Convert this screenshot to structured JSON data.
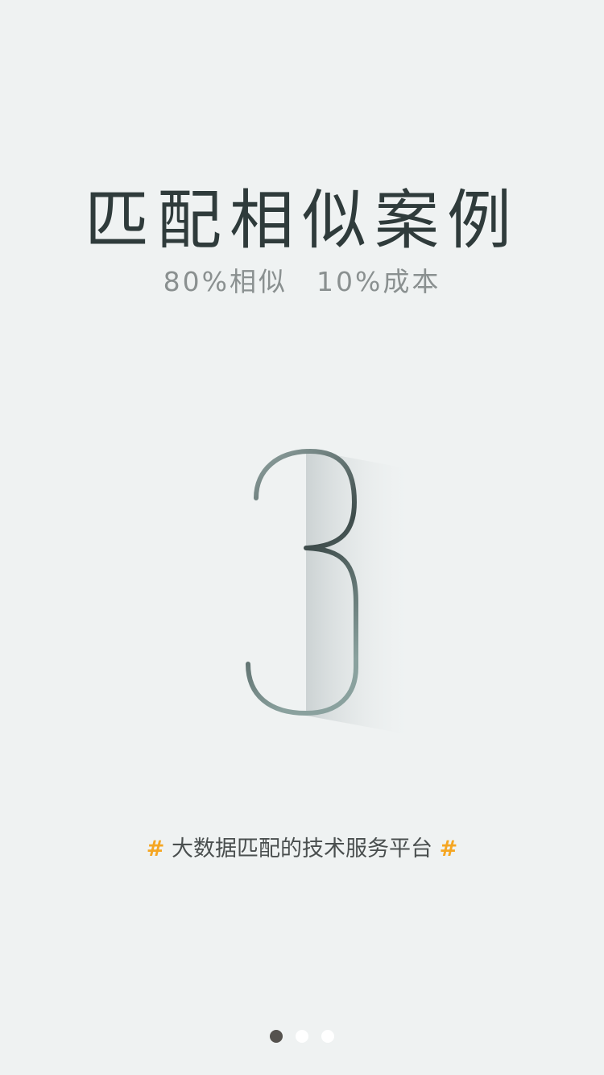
{
  "onboarding": {
    "title": "匹配相似案例",
    "subtitle_left": "80%相似",
    "subtitle_right": "10%成本",
    "step_number": "3",
    "tagline_hash_left": "#",
    "tagline_text": "大数据匹配的技术服务平台",
    "tagline_hash_right": "#",
    "accent_color": "#f5a623",
    "pager": {
      "total": 3,
      "active_index": 0
    }
  }
}
